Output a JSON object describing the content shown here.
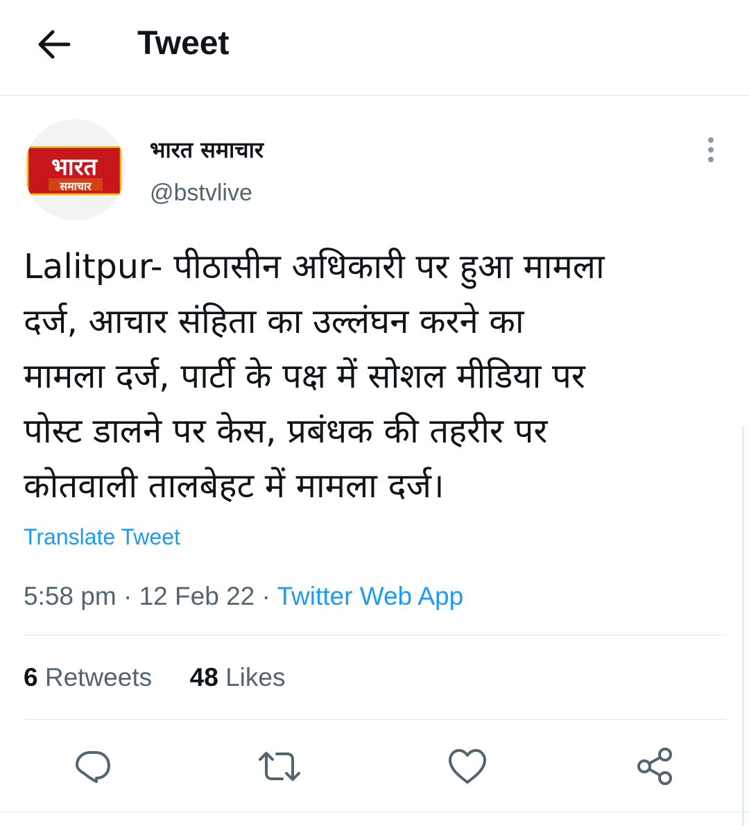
{
  "header": {
    "title": "Tweet"
  },
  "author": {
    "display_name": "भारत समाचार",
    "handle": "@bstvlive",
    "avatar": {
      "logo_line1": "भारत",
      "logo_line2": "समाचार"
    }
  },
  "tweet": {
    "lines": [
      "Lalitpur- पीठासीन अधिकारी पर हुआ मामला",
      "दर्ज, आचार संहिता का उल्लंघन करने का",
      "मामला दर्ज, पार्टी के पक्ष में सोशल मीडिया पर",
      "पोस्ट डालने पर केस, प्रबंधक की तहरीर पर",
      "कोतवाली तालबेहट में मामला दर्ज।"
    ],
    "translate_label": "Translate Tweet",
    "time": "5:58 pm",
    "date": "12 Feb 22",
    "separator": "·",
    "source": "Twitter Web App"
  },
  "stats": {
    "retweets_count": "6",
    "retweets_label": "Retweets",
    "likes_count": "48",
    "likes_label": "Likes"
  },
  "icons": {
    "back": "arrow-left-icon",
    "more": "vertical-dots-icon",
    "reply": "reply-icon",
    "retweet": "retweet-icon",
    "like": "heart-icon",
    "share": "share-icon"
  },
  "colors": {
    "link": "#1d9bf0",
    "secondary_text": "#536471",
    "primary_text": "#0f1419",
    "divider": "#e1e8ed",
    "logo_red": "#c8161d",
    "logo_gold": "#f2c200"
  }
}
